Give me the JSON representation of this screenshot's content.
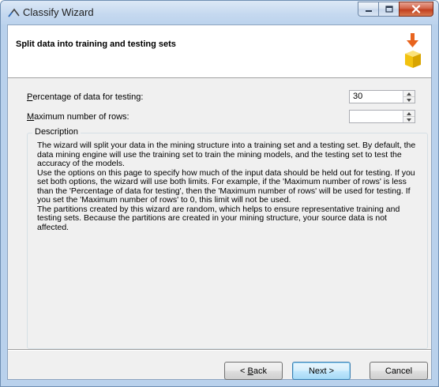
{
  "window": {
    "title": "Classify Wizard"
  },
  "header": {
    "title": "Split data into training and testing sets"
  },
  "fields": {
    "percentage": {
      "mnemonic": "P",
      "label_rest": "ercentage of data for testing:",
      "value": "30"
    },
    "max_rows": {
      "mnemonic": "M",
      "label_rest": "aximum number of rows:",
      "value": ""
    }
  },
  "description": {
    "title": "Description",
    "paragraphs": [
      "The wizard will split your data in the mining structure into a training set and a testing set. By default, the data mining engine will use the training set to train the mining models, and the testing set to test the accuracy of the models.",
      "Use the options on this page to specify how much of the input data should be held out for testing. If you set both options, the wizard will use both limits. For example, if the 'Maximum number of rows' is less than the 'Percentage of data for testing', then the 'Maximum number of rows' will be used for testing. If you set the 'Maximum number of rows' to 0, this limit will not be used.",
      "The partitions created by this wizard are random, which helps to ensure representative training and testing sets. Because the partitions are created in your mining structure, your source data is not affected."
    ]
  },
  "buttons": {
    "back_prefix": "< ",
    "back_mnemonic": "B",
    "back_rest": "ack",
    "next": "Next >",
    "cancel": "Cancel"
  },
  "colors": {
    "titlebar": "#c4d8ef",
    "close_button": "#c2401f",
    "arrow": "#e8641e",
    "cube": "#f2c20f",
    "default_button": "#bee6fd"
  }
}
